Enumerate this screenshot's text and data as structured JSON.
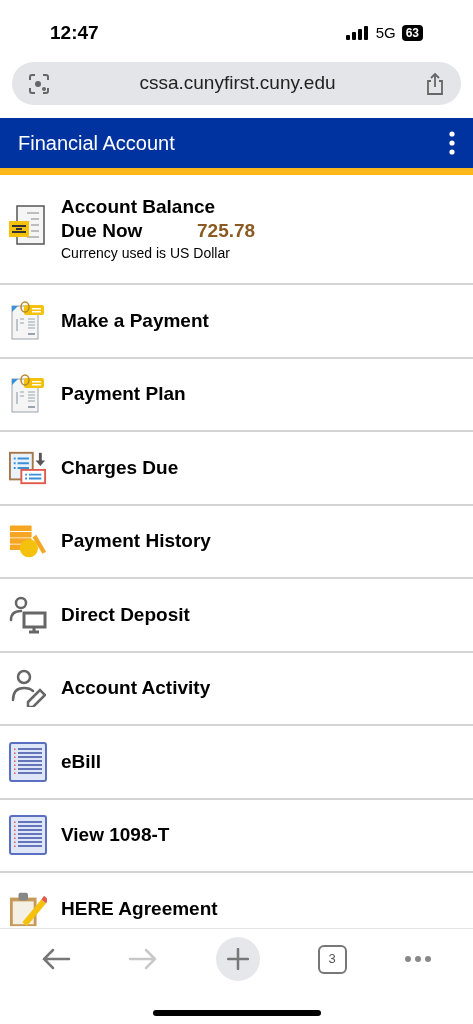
{
  "status_bar": {
    "time": "12:47",
    "network": "5G",
    "battery": "63"
  },
  "browser": {
    "url": "cssa.cunyfirst.cuny.edu",
    "tab_count": "3"
  },
  "header": {
    "title": "Financial Account"
  },
  "balance": {
    "title": "Account Balance",
    "label": "Due Now",
    "amount": "725.78",
    "note": "Currency used is US Dollar"
  },
  "menu_items": [
    {
      "label": "Make a Payment",
      "kind": "clip-doc"
    },
    {
      "label": "Payment Plan",
      "kind": "clip-doc"
    },
    {
      "label": "Charges Due",
      "kind": "charges"
    },
    {
      "label": "Payment History",
      "kind": "coins"
    },
    {
      "label": "Direct Deposit",
      "kind": "person-monitor"
    },
    {
      "label": "Account Activity",
      "kind": "person-pencil"
    },
    {
      "label": "eBill",
      "kind": "list-doc"
    },
    {
      "label": "View 1098-T",
      "kind": "list-doc"
    },
    {
      "label": "HERE Agreement",
      "kind": "clipboard-pencil"
    }
  ]
}
